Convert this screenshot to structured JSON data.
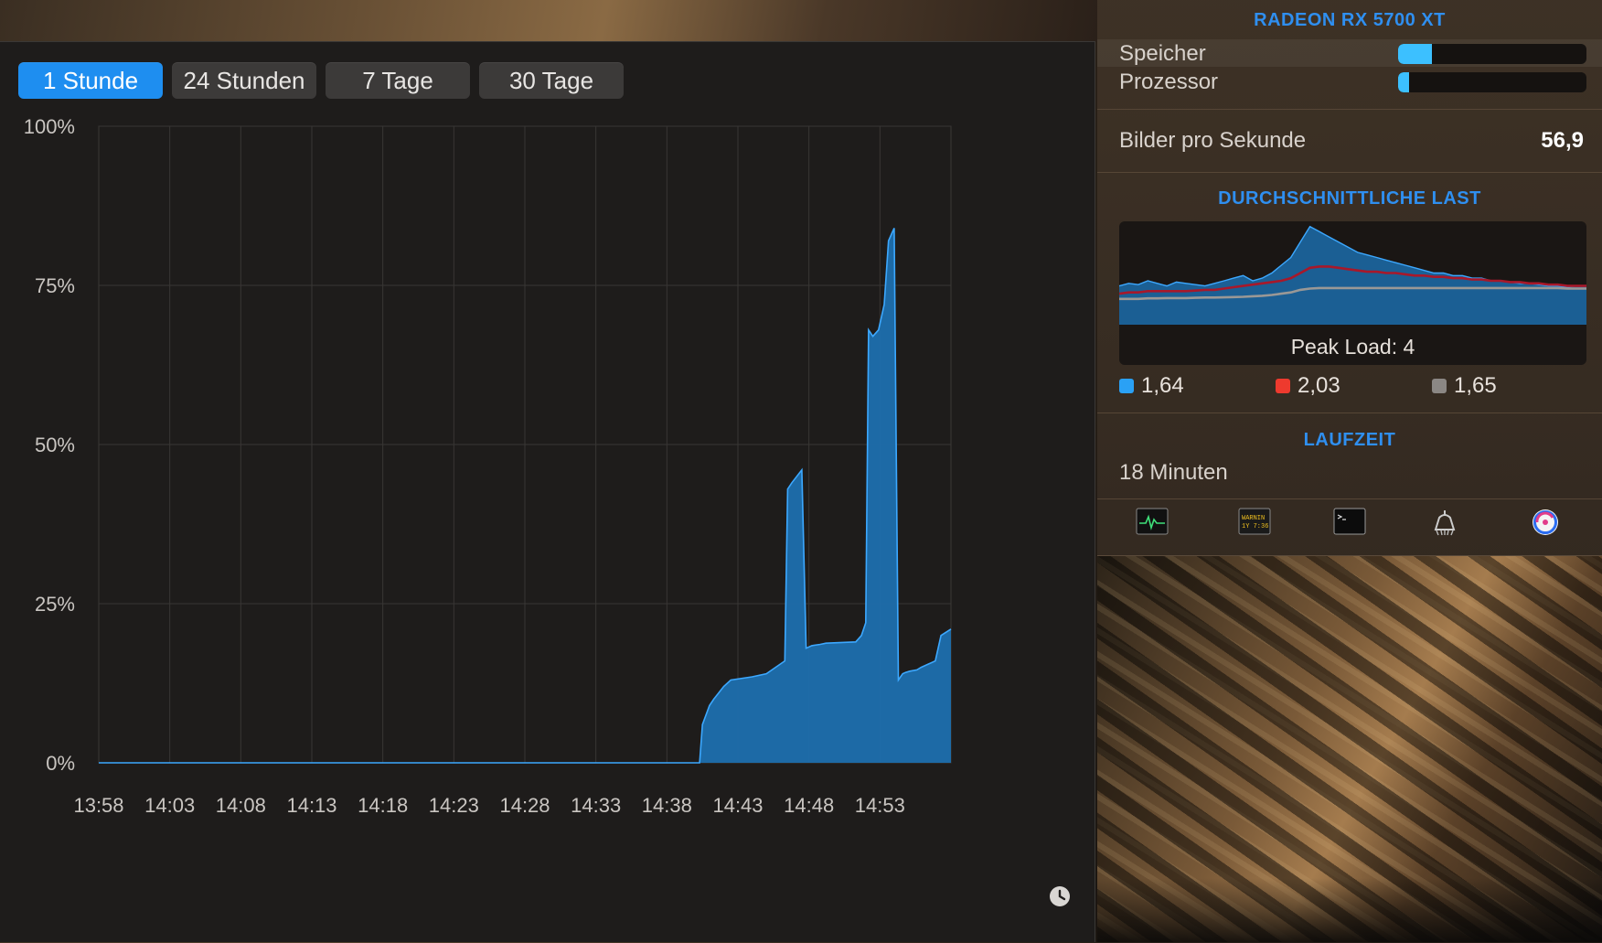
{
  "history": {
    "tabs": [
      {
        "label": "1 Stunde",
        "active": true
      },
      {
        "label": "24 Stunden",
        "active": false
      },
      {
        "label": "7 Tage",
        "active": false
      },
      {
        "label": "30 Tage",
        "active": false
      }
    ],
    "clock_icon": "clock-icon"
  },
  "chart_data": {
    "type": "area",
    "y_ticks": [
      "0%",
      "25%",
      "50%",
      "75%",
      "100%"
    ],
    "x_ticks": [
      "13:58",
      "14:03",
      "14:08",
      "14:13",
      "14:18",
      "14:23",
      "14:28",
      "14:33",
      "14:38",
      "14:43",
      "14:48",
      "14:53"
    ],
    "ylim": [
      0,
      100
    ],
    "xlim_minutes": [
      0,
      60
    ],
    "grid": true,
    "color": "#1e6fae",
    "line_color": "#3ca8ff",
    "series": [
      {
        "x": [
          0,
          42.3,
          42.5,
          43.0,
          43.3,
          44.0,
          44.5,
          46.0,
          47.0,
          48.3,
          48.5,
          48.8,
          49.5,
          49.8,
          50.0,
          50.2,
          50.8,
          51.2,
          53.3,
          53.7,
          54.0,
          54.2,
          54.5,
          54.9,
          55.3,
          55.6,
          55.8,
          56.0,
          56.3,
          56.6,
          56.8,
          57.1,
          57.6,
          57.9,
          58.9,
          59.3,
          60.0
        ],
        "y": [
          0,
          0,
          6,
          9,
          10,
          12,
          13,
          13.5,
          14,
          16,
          43,
          44,
          46,
          18,
          18.2,
          18.4,
          18.6,
          18.8,
          19,
          20,
          22,
          68,
          67,
          68,
          72,
          82,
          83,
          84,
          13,
          14,
          14.2,
          14.4,
          14.6,
          15,
          16,
          20,
          21
        ]
      }
    ]
  },
  "gpu": {
    "heading": "RADEON RX 5700 XT",
    "memory_label": "Speicher",
    "memory_fraction": 0.18,
    "processor_label": "Prozessor",
    "processor_fraction": 0.06
  },
  "fps": {
    "label": "Bilder pro Sekunde",
    "value": "56,9"
  },
  "load": {
    "heading": "DURCHSCHNITTLICHE LAST",
    "peak_label": "Peak Load: 4",
    "legend": [
      {
        "value": "1,64",
        "color": "#2aa1f5"
      },
      {
        "value": "2,03",
        "color": "#ee3a2e"
      },
      {
        "value": "1,65",
        "color": "#8b8784"
      }
    ],
    "series_fill": [
      1.5,
      1.6,
      1.55,
      1.7,
      1.6,
      1.5,
      1.65,
      1.6,
      1.55,
      1.5,
      1.6,
      1.7,
      1.8,
      1.9,
      1.7,
      1.8,
      2.0,
      2.3,
      2.6,
      3.2,
      3.8,
      3.6,
      3.4,
      3.2,
      3.0,
      2.8,
      2.7,
      2.6,
      2.5,
      2.4,
      2.3,
      2.2,
      2.1,
      2.0,
      2.0,
      1.9,
      1.9,
      1.8,
      1.8,
      1.7,
      1.7,
      1.65,
      1.6,
      1.6,
      1.55,
      1.5,
      1.5,
      1.45,
      1.5,
      1.5
    ],
    "series_5min": [
      1.2,
      1.25,
      1.25,
      1.3,
      1.3,
      1.3,
      1.3,
      1.3,
      1.32,
      1.35,
      1.35,
      1.4,
      1.45,
      1.5,
      1.55,
      1.6,
      1.65,
      1.7,
      1.8,
      2.0,
      2.2,
      2.25,
      2.25,
      2.2,
      2.15,
      2.1,
      2.05,
      2.05,
      2.0,
      2.0,
      1.95,
      1.9,
      1.9,
      1.85,
      1.85,
      1.8,
      1.8,
      1.75,
      1.75,
      1.7,
      1.7,
      1.65,
      1.65,
      1.6,
      1.6,
      1.55,
      1.55,
      1.5,
      1.5,
      1.5
    ],
    "series_15min": [
      1.0,
      1.0,
      1.0,
      1.02,
      1.02,
      1.03,
      1.03,
      1.03,
      1.04,
      1.05,
      1.05,
      1.06,
      1.07,
      1.08,
      1.1,
      1.12,
      1.15,
      1.2,
      1.25,
      1.35,
      1.4,
      1.42,
      1.42,
      1.42,
      1.42,
      1.42,
      1.42,
      1.42,
      1.42,
      1.42,
      1.42,
      1.42,
      1.42,
      1.42,
      1.42,
      1.42,
      1.42,
      1.42,
      1.42,
      1.42,
      1.42,
      1.42,
      1.42,
      1.42,
      1.42,
      1.42,
      1.42,
      1.4,
      1.4,
      1.4
    ],
    "ymax": 4
  },
  "uptime": {
    "heading": "LAUFZEIT",
    "value": "18 Minuten"
  },
  "dock": {
    "icons": [
      "activity-monitor-icon",
      "console-icon",
      "terminal-icon",
      "disk-cleaner-icon",
      "istat-menus-icon"
    ],
    "console_text_line1": "WARNIN",
    "console_text_line2": "1Y 7:36"
  }
}
